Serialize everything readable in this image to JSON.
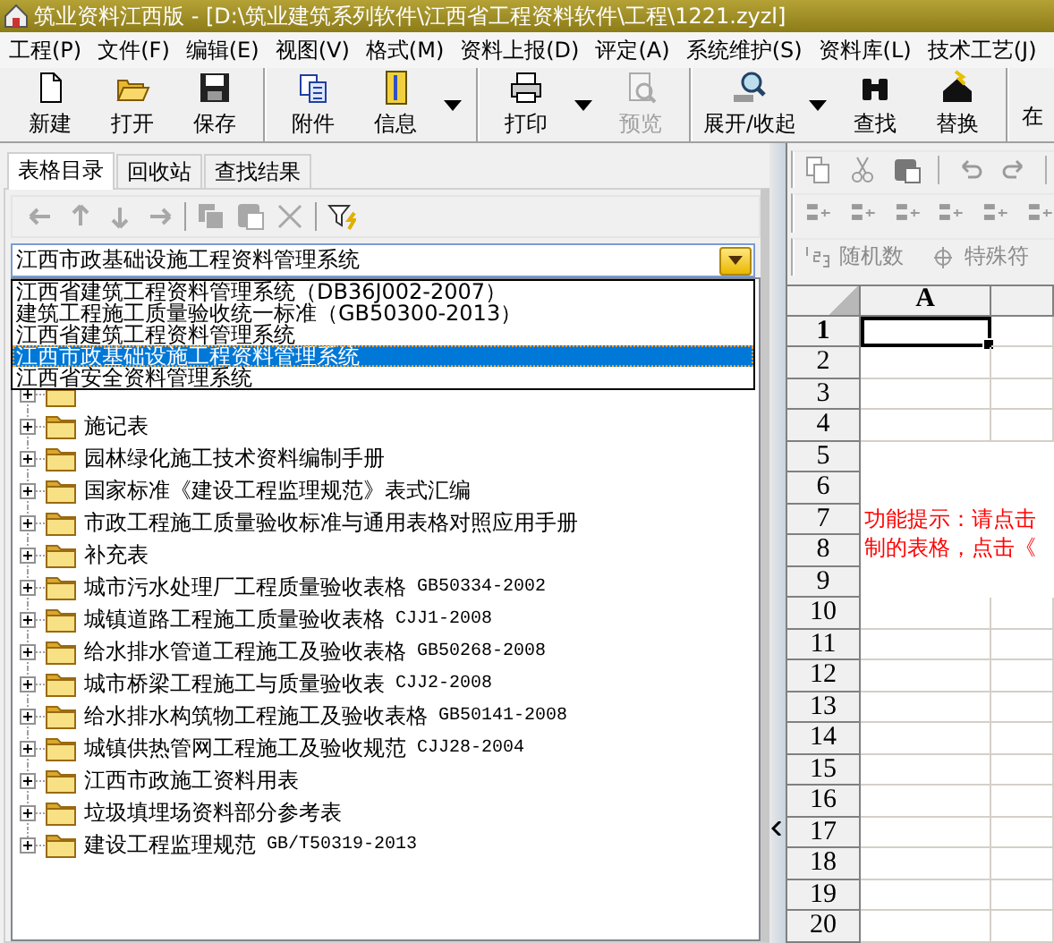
{
  "window": {
    "title": "筑业资料江西版 - [D:\\筑业建筑系列软件\\江西省工程资料软件\\工程\\1221.zyzl]"
  },
  "menu": [
    "工程(P)",
    "文件(F)",
    "编辑(E)",
    "视图(V)",
    "格式(M)",
    "资料上报(D)",
    "评定(A)",
    "系统维护(S)",
    "资料库(L)",
    "技术工艺(J)"
  ],
  "toolbar": [
    {
      "buttons": [
        {
          "label": "新建",
          "kind": "new",
          "disabled": false,
          "menu_arrow": false
        },
        {
          "label": "打开",
          "kind": "open",
          "disabled": false,
          "menu_arrow": false
        },
        {
          "label": "保存",
          "kind": "save",
          "disabled": false,
          "menu_arrow": false
        }
      ]
    },
    {
      "buttons": [
        {
          "label": "附件",
          "kind": "attach",
          "disabled": false,
          "menu_arrow": false
        },
        {
          "label": "信息",
          "kind": "info",
          "disabled": false,
          "menu_arrow": true
        }
      ]
    },
    {
      "buttons": [
        {
          "label": "打印",
          "kind": "print",
          "disabled": false,
          "menu_arrow": true
        },
        {
          "label": "预览",
          "kind": "preview",
          "disabled": true,
          "menu_arrow": false
        }
      ]
    },
    {
      "buttons": [
        {
          "label": "展开/收起",
          "kind": "expand",
          "disabled": false,
          "menu_arrow": true
        },
        {
          "label": "查找",
          "kind": "find",
          "disabled": false,
          "menu_arrow": false
        },
        {
          "label": "替换",
          "kind": "replace",
          "disabled": false,
          "menu_arrow": false
        }
      ]
    },
    {
      "buttons": [
        {
          "label": "在",
          "disabled": false,
          "menu_arrow": false
        }
      ]
    }
  ],
  "catalog": {
    "tabs": [
      {
        "label": "表格目录",
        "selected": true
      },
      {
        "label": "回收站",
        "selected": false
      },
      {
        "label": "查找结果",
        "selected": false
      }
    ],
    "tools": [
      {
        "kind": "back",
        "disabled": true
      },
      {
        "kind": "up",
        "disabled": true
      },
      {
        "kind": "down",
        "disabled": true
      },
      {
        "kind": "forward",
        "disabled": true
      },
      {
        "kind": "copy",
        "disabled": true
      },
      {
        "kind": "paste",
        "disabled": true
      },
      {
        "kind": "delete",
        "disabled": true
      },
      {
        "kind": "filter",
        "disabled": false
      }
    ],
    "combo": {
      "value": "江西市政基础设施工程资料管理系统"
    },
    "dropdown": {
      "items": [
        {
          "label": "江西省建筑工程资料管理系统（DB36J002-2007）",
          "selected": false
        },
        {
          "label": "建筑工程施工质量验收统一标准（GB50300-2013）",
          "selected": false
        },
        {
          "label": "江西省建筑工程资料管理系统",
          "selected": false
        },
        {
          "label": "江西市政基础设施工程资料管理系统",
          "selected": true
        },
        {
          "label": "江西省安全资料管理系统",
          "selected": false
        }
      ]
    },
    "tree": [
      {
        "expanded": false
      },
      {
        "label": "施记表",
        "expanded": false
      },
      {
        "label": "园林绿化施工技术资料编制手册",
        "expanded": false
      },
      {
        "label": "国家标准《建设工程监理规范》表式汇编",
        "expanded": false
      },
      {
        "label": "市政工程施工质量验收标准与通用表格对照应用手册",
        "expanded": false
      },
      {
        "label": "补充表",
        "expanded": false
      },
      {
        "label": "城市污水处理厂工程质量验收表格",
        "code": "GB50334-2002",
        "expanded": false
      },
      {
        "label": "城镇道路工程施工质量验收表格",
        "code": "CJJ1-2008",
        "expanded": false
      },
      {
        "label": "给水排水管道工程施工及验收表格",
        "code": "GB50268-2008",
        "expanded": false
      },
      {
        "label": "城市桥梁工程施工与质量验收表",
        "code": "CJJ2-2008",
        "expanded": false
      },
      {
        "label": "给水排水构筑物工程施工及验收表格",
        "code": "GB50141-2008",
        "expanded": false
      },
      {
        "label": "城镇供热管网工程施工及验收规范",
        "code": "CJJ28-2004",
        "expanded": false
      },
      {
        "label": "江西市政施工资料用表",
        "expanded": false
      },
      {
        "label": "垃圾填埋场资料部分参考表",
        "expanded": false
      },
      {
        "label": "建设工程监理规范",
        "code": "GB/T50319-2013",
        "expanded": false
      }
    ]
  },
  "sheet": {
    "tools": [
      {
        "label": "随机数",
        "kind": "random",
        "disabled": true
      },
      {
        "label": "特殊符",
        "kind": "symbol",
        "disabled": true
      }
    ],
    "columns": [
      {
        "label": "A",
        "selected": true
      }
    ],
    "rows": [
      {
        "label": "1",
        "kind": "cells",
        "selected": true
      },
      {
        "label": "2",
        "kind": "cells",
        "selected": false
      },
      {
        "label": "3",
        "kind": "cells",
        "selected": false
      },
      {
        "label": "4",
        "kind": "cells",
        "selected": false
      },
      {
        "label": "5",
        "kind": "note",
        "selected": false
      },
      {
        "label": "6",
        "kind": "note",
        "selected": false
      },
      {
        "label": "7",
        "kind": "note",
        "selected": false
      },
      {
        "label": "8",
        "kind": "note",
        "selected": false
      },
      {
        "label": "9",
        "kind": "note",
        "selected": false
      },
      {
        "label": "10",
        "kind": "cells",
        "selected": false
      },
      {
        "label": "11",
        "kind": "cells",
        "selected": false
      },
      {
        "label": "12",
        "kind": "cells",
        "selected": false
      },
      {
        "label": "13",
        "kind": "cells",
        "selected": false
      },
      {
        "label": "14",
        "kind": "cells",
        "selected": false
      },
      {
        "label": "15",
        "kind": "cells",
        "selected": false
      },
      {
        "label": "16",
        "kind": "cells",
        "selected": false
      },
      {
        "label": "17",
        "kind": "cells",
        "selected": false
      },
      {
        "label": "18",
        "kind": "cells",
        "selected": false
      },
      {
        "label": "19",
        "kind": "cells",
        "selected": false
      },
      {
        "label": "20",
        "kind": "cells",
        "selected": false
      }
    ],
    "hint": [
      "功能提示：请点击",
      "制的表格，点击《"
    ]
  }
}
